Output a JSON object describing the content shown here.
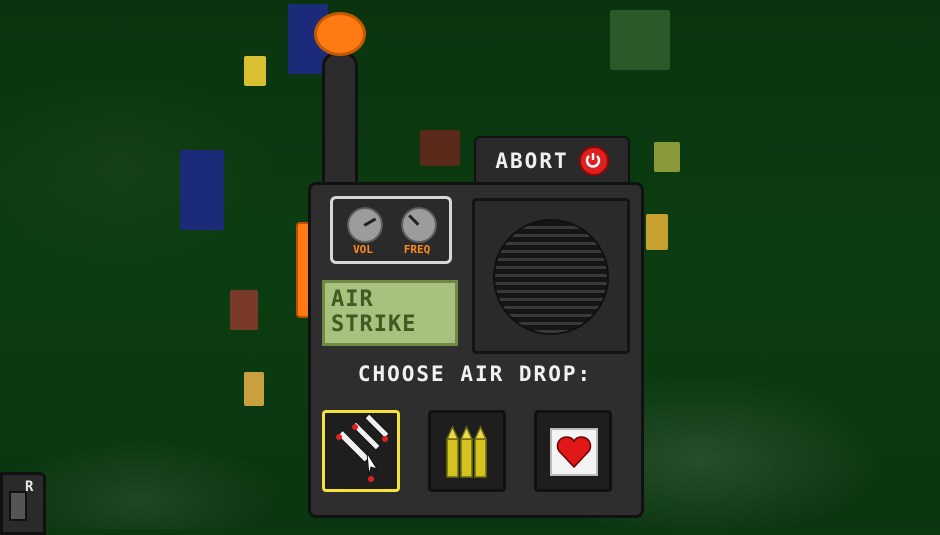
{
  "abort": {
    "label": "ABORT",
    "icon": "power-icon"
  },
  "knobs": {
    "vol_label": "VOL",
    "freq_label": "FREQ"
  },
  "display": {
    "line1": "AIR",
    "line2": "STRIKE"
  },
  "choose_label": "CHOOSE AIR DROP:",
  "drops": [
    {
      "name": "air-strike",
      "icon": "missiles-icon",
      "selected": true
    },
    {
      "name": "ammo",
      "icon": "bullets-icon",
      "selected": false
    },
    {
      "name": "health",
      "icon": "heart-icon",
      "selected": false
    }
  ],
  "corner": {
    "label": "R",
    "icon": "radio-icon"
  },
  "colors": {
    "accent": "#ff7a12",
    "selected": "#f5e23a",
    "lcd": "#a7c27e",
    "abort_icon": "#e02020"
  }
}
